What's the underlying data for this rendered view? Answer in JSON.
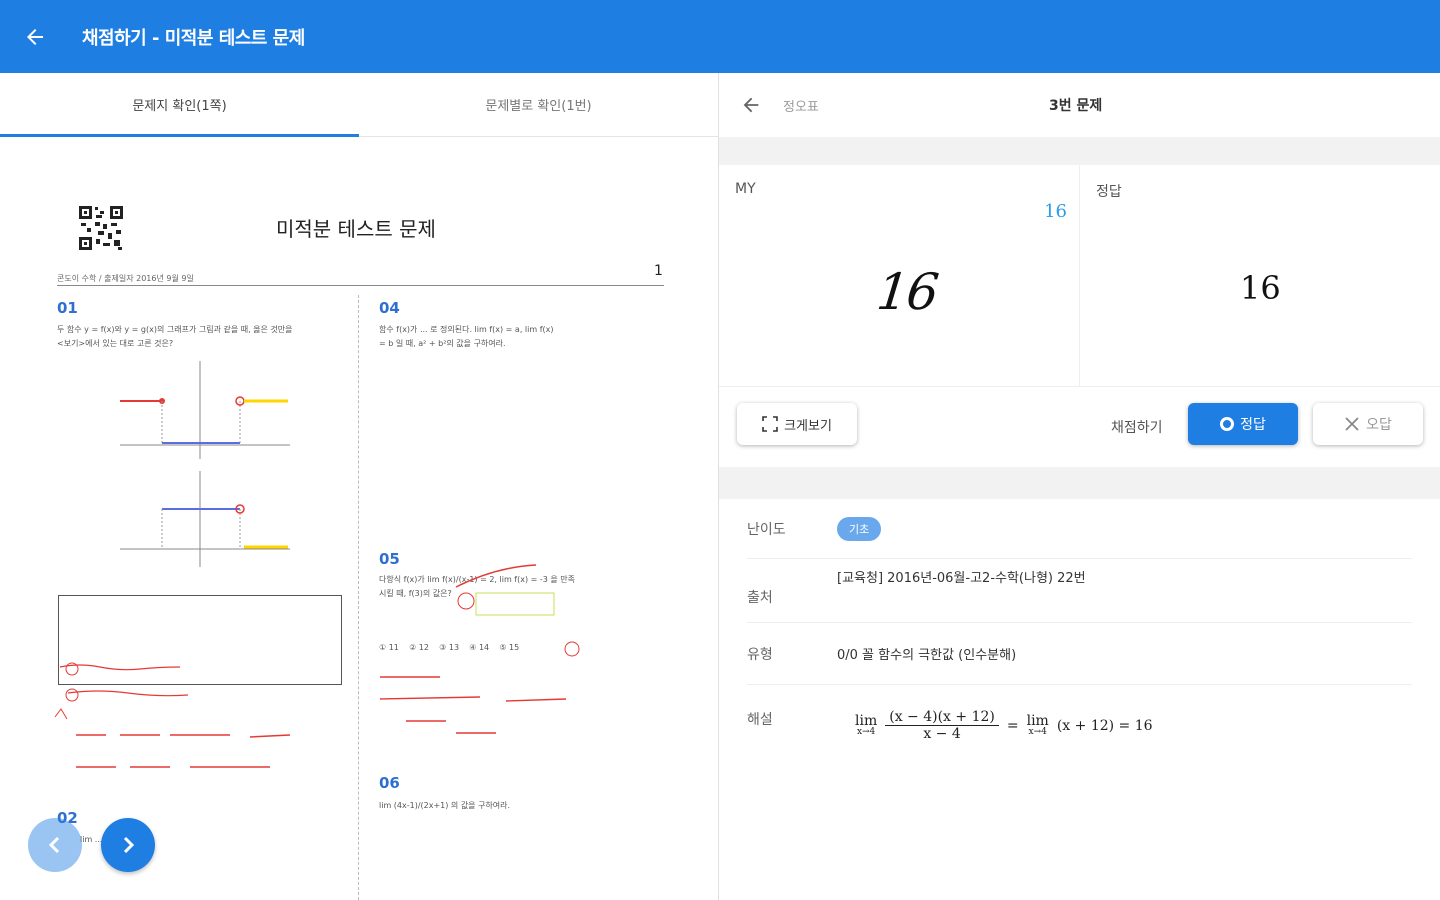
{
  "appbar": {
    "title": "채점하기 - 미적분 테스트 문제",
    "color": "#1e7ee2"
  },
  "left_tabs": [
    {
      "label": "문제지 확인(1쪽)",
      "active": true
    },
    {
      "label": "문제별로 확인(1번)",
      "active": false
    }
  ],
  "paper": {
    "title": "미적분 테스트 문제",
    "subline": "콘도이 수학 / 출제일자 2016년 9월 9일",
    "page_number": "1",
    "questions": [
      {
        "number": "01",
        "text": "두 함수 y = f(x)와 y = g(x)의 그래프가 그림과 같을 때, 옳은 것만을 <보기>에서 있는 대로 고른 것은?"
      },
      {
        "number": "04",
        "text": "함수 f(x)가 ... 로 정의된다. lim f(x) = a, lim f(x) = b 일 때, a² + b²의 값을 구하여라."
      },
      {
        "number": "05",
        "text": "다항식 f(x)가 lim f(x)/(x-1) = 2, lim f(x) = -3 을 만족시킬 때, f(3)의 값은?"
      },
      {
        "number": "06",
        "text": "lim (4x-1)/(2x+1) 의 값을 구하여라."
      },
      {
        "number": "02",
        "text": "lim ..."
      }
    ],
    "choices_05": [
      "① 11",
      "② 12",
      "③ 13",
      "④ 14",
      "⑤ 15"
    ]
  },
  "right": {
    "back_label": "정오표",
    "question_title": "3번 문제",
    "my_label": "MY",
    "my_typed_answer": "16",
    "my_handwritten_answer": "16",
    "correct_label": "정답",
    "correct_answer": "16",
    "zoom_label": "크게보기",
    "grade_label": "채점하기",
    "correct_button": "정답",
    "wrong_button": "오답",
    "info": {
      "difficulty_label": "난이도",
      "difficulty_value": "기초",
      "source_label": "출처",
      "source_value": "[교육청] 2016년-06월-고2-수학(나형) 22번",
      "type_label": "유형",
      "type_value": "0/0 꼴 함수의 극한값 (인수분해)",
      "solution_label": "해설",
      "solution": {
        "lim1": "lim",
        "lim1_sub": "x→4",
        "numerator": "(x − 4)(x + 12)",
        "denominator": "x − 4",
        "equals": "=",
        "lim2": "lim",
        "lim2_sub": "x→4",
        "rest": "(x + 12) = 16"
      }
    }
  }
}
